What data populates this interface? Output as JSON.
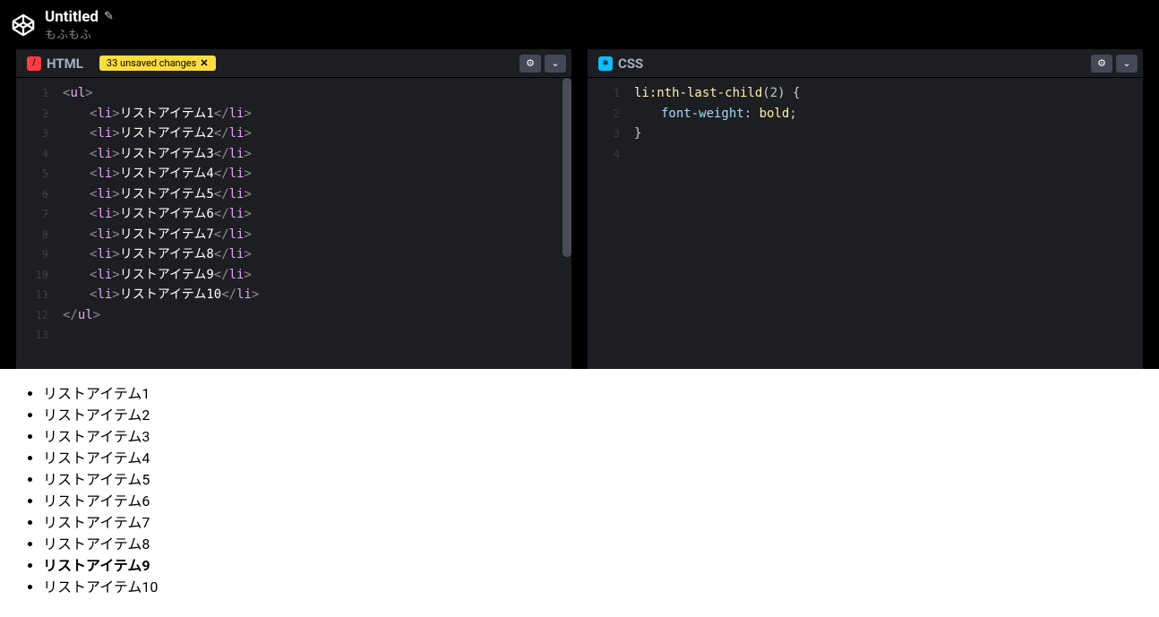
{
  "header": {
    "title": "Untitled",
    "author": "もふもふ"
  },
  "panels": {
    "html": {
      "label": "HTML",
      "icon_char": "/",
      "unsaved_badge": "33 unsaved changes",
      "lines": [
        {
          "n": "1",
          "fold": true,
          "indent": 0,
          "parts": [
            {
              "t": "<",
              "c": "bracket"
            },
            {
              "t": "ul",
              "c": "tag"
            },
            {
              "t": ">",
              "c": "bracket"
            }
          ]
        },
        {
          "n": "2",
          "fold": true,
          "indent": 1,
          "parts": [
            {
              "t": "<",
              "c": "bracket"
            },
            {
              "t": "li",
              "c": "tag"
            },
            {
              "t": ">",
              "c": "bracket"
            },
            {
              "t": "リストアイテム1",
              "c": "txt"
            },
            {
              "t": "</",
              "c": "bracket"
            },
            {
              "t": "li",
              "c": "tag"
            },
            {
              "t": ">",
              "c": "bracket"
            }
          ]
        },
        {
          "n": "3",
          "fold": true,
          "indent": 1,
          "parts": [
            {
              "t": "<",
              "c": "bracket"
            },
            {
              "t": "li",
              "c": "tag"
            },
            {
              "t": ">",
              "c": "bracket"
            },
            {
              "t": "リストアイテム2",
              "c": "txt"
            },
            {
              "t": "</",
              "c": "bracket"
            },
            {
              "t": "li",
              "c": "tag"
            },
            {
              "t": ">",
              "c": "bracket"
            }
          ]
        },
        {
          "n": "4",
          "fold": true,
          "indent": 1,
          "parts": [
            {
              "t": "<",
              "c": "bracket"
            },
            {
              "t": "li",
              "c": "tag"
            },
            {
              "t": ">",
              "c": "bracket"
            },
            {
              "t": "リストアイテム3",
              "c": "txt"
            },
            {
              "t": "</",
              "c": "bracket"
            },
            {
              "t": "li",
              "c": "tag"
            },
            {
              "t": ">",
              "c": "bracket"
            }
          ]
        },
        {
          "n": "5",
          "fold": true,
          "indent": 1,
          "parts": [
            {
              "t": "<",
              "c": "bracket"
            },
            {
              "t": "li",
              "c": "tag"
            },
            {
              "t": ">",
              "c": "bracket"
            },
            {
              "t": "リストアイテム4",
              "c": "txt"
            },
            {
              "t": "</",
              "c": "bracket"
            },
            {
              "t": "li",
              "c": "tag"
            },
            {
              "t": ">",
              "c": "bracket"
            }
          ]
        },
        {
          "n": "6",
          "fold": true,
          "indent": 1,
          "parts": [
            {
              "t": "<",
              "c": "bracket"
            },
            {
              "t": "li",
              "c": "tag"
            },
            {
              "t": ">",
              "c": "bracket"
            },
            {
              "t": "リストアイテム5",
              "c": "txt"
            },
            {
              "t": "</",
              "c": "bracket"
            },
            {
              "t": "li",
              "c": "tag"
            },
            {
              "t": ">",
              "c": "bracket"
            }
          ]
        },
        {
          "n": "7",
          "fold": true,
          "indent": 1,
          "parts": [
            {
              "t": "<",
              "c": "bracket"
            },
            {
              "t": "li",
              "c": "tag"
            },
            {
              "t": ">",
              "c": "bracket"
            },
            {
              "t": "リストアイテム6",
              "c": "txt"
            },
            {
              "t": "</",
              "c": "bracket"
            },
            {
              "t": "li",
              "c": "tag"
            },
            {
              "t": ">",
              "c": "bracket"
            }
          ]
        },
        {
          "n": "8",
          "fold": true,
          "indent": 1,
          "parts": [
            {
              "t": "<",
              "c": "bracket"
            },
            {
              "t": "li",
              "c": "tag"
            },
            {
              "t": ">",
              "c": "bracket"
            },
            {
              "t": "リストアイテム7",
              "c": "txt"
            },
            {
              "t": "</",
              "c": "bracket"
            },
            {
              "t": "li",
              "c": "tag"
            },
            {
              "t": ">",
              "c": "bracket"
            }
          ]
        },
        {
          "n": "9",
          "fold": true,
          "indent": 1,
          "parts": [
            {
              "t": "<",
              "c": "bracket"
            },
            {
              "t": "li",
              "c": "tag"
            },
            {
              "t": ">",
              "c": "bracket"
            },
            {
              "t": "リストアイテム8",
              "c": "txt"
            },
            {
              "t": "</",
              "c": "bracket"
            },
            {
              "t": "li",
              "c": "tag"
            },
            {
              "t": ">",
              "c": "bracket"
            }
          ]
        },
        {
          "n": "10",
          "fold": true,
          "indent": 1,
          "parts": [
            {
              "t": "<",
              "c": "bracket"
            },
            {
              "t": "li",
              "c": "tag"
            },
            {
              "t": ">",
              "c": "bracket"
            },
            {
              "t": "リストアイテム9",
              "c": "txt"
            },
            {
              "t": "</",
              "c": "bracket"
            },
            {
              "t": "li",
              "c": "tag"
            },
            {
              "t": ">",
              "c": "bracket"
            }
          ]
        },
        {
          "n": "11",
          "fold": true,
          "indent": 1,
          "parts": [
            {
              "t": "<",
              "c": "bracket"
            },
            {
              "t": "li",
              "c": "tag"
            },
            {
              "t": ">",
              "c": "bracket"
            },
            {
              "t": "リストアイテム10",
              "c": "txt"
            },
            {
              "t": "</",
              "c": "bracket"
            },
            {
              "t": "li",
              "c": "tag"
            },
            {
              "t": ">",
              "c": "bracket"
            }
          ]
        },
        {
          "n": "12",
          "fold": false,
          "indent": 0,
          "parts": [
            {
              "t": "</",
              "c": "bracket"
            },
            {
              "t": "ul",
              "c": "tag"
            },
            {
              "t": ">",
              "c": "bracket"
            }
          ]
        },
        {
          "n": "13",
          "fold": false,
          "indent": 0,
          "parts": []
        }
      ]
    },
    "css": {
      "label": "CSS",
      "icon_char": "∗",
      "lines": [
        {
          "n": "1",
          "fold": false,
          "indent": 0,
          "parts": [
            {
              "t": "li",
              "c": "kw"
            },
            {
              "t": ":nth-last-child",
              "c": "kw"
            },
            {
              "t": "(",
              "c": "punc"
            },
            {
              "t": "2",
              "c": "num"
            },
            {
              "t": ")",
              "c": "punc"
            },
            {
              "t": " {",
              "c": "punc"
            }
          ]
        },
        {
          "n": "2",
          "fold": false,
          "indent": 1,
          "parts": [
            {
              "t": "font-weight",
              "c": "prop"
            },
            {
              "t": ": ",
              "c": "punc"
            },
            {
              "t": "bold",
              "c": "kw"
            },
            {
              "t": ";",
              "c": "punc"
            }
          ]
        },
        {
          "n": "3",
          "fold": false,
          "indent": 0,
          "parts": [
            {
              "t": "}",
              "c": "punc"
            }
          ]
        },
        {
          "n": "4",
          "fold": false,
          "indent": 0,
          "parts": []
        }
      ]
    }
  },
  "output": {
    "items": [
      {
        "text": "リストアイテム1",
        "bold": false
      },
      {
        "text": "リストアイテム2",
        "bold": false
      },
      {
        "text": "リストアイテム3",
        "bold": false
      },
      {
        "text": "リストアイテム4",
        "bold": false
      },
      {
        "text": "リストアイテム5",
        "bold": false
      },
      {
        "text": "リストアイテム6",
        "bold": false
      },
      {
        "text": "リストアイテム7",
        "bold": false
      },
      {
        "text": "リストアイテム8",
        "bold": false
      },
      {
        "text": "リストアイテム9",
        "bold": true
      },
      {
        "text": "リストアイテム10",
        "bold": false
      }
    ]
  }
}
